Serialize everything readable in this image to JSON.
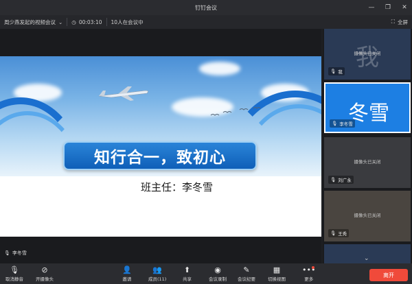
{
  "window": {
    "title": "钉钉会议",
    "controls": [
      "—",
      "❐",
      "✕"
    ]
  },
  "infobar": {
    "meeting_name": "周少燕发起的视频会议",
    "duration": "00:03:10",
    "attendees": "10人在会议中",
    "fullscreen_label": "全屏"
  },
  "slide": {
    "headline": "知行合一，致初心",
    "teacher": "班主任：李冬雪"
  },
  "stage": {
    "speaker": "李冬雪"
  },
  "participants": [
    {
      "big": "我",
      "status": "摄像头已关闭",
      "name": "我"
    },
    {
      "big": "冬雪",
      "status": "",
      "name": "李冬雪"
    },
    {
      "big": "",
      "status": "摄像头已关闭",
      "name": "刘广永"
    },
    {
      "big": "",
      "status": "摄像头已关闭",
      "name": "王秀"
    }
  ],
  "toolbar": {
    "mute": "取消静音",
    "camera": "开摄像头",
    "invite": "邀请",
    "members": "成员(11)",
    "share": "共享",
    "record": "会议录制",
    "minutes": "会议纪要",
    "layout": "切换视图",
    "more": "更多",
    "leave": "离开"
  },
  "colors": {
    "accent": "#1d7fe3",
    "leave": "#f04a3a"
  }
}
